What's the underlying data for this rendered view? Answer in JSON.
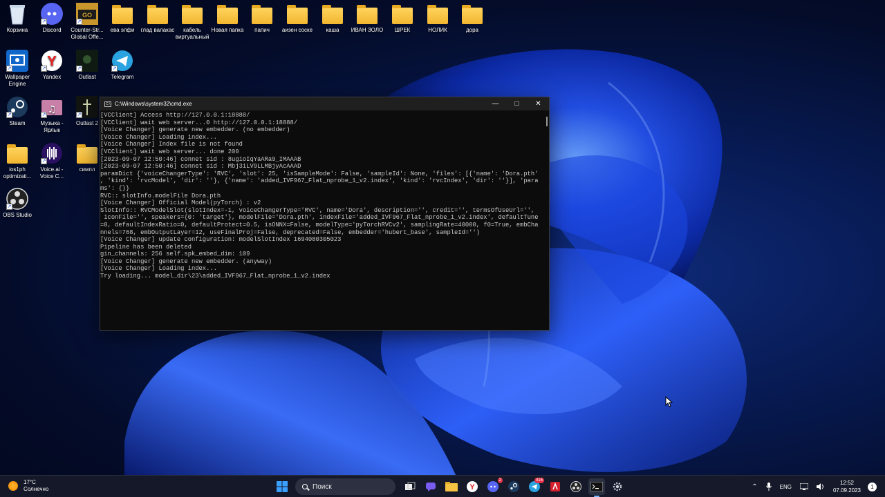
{
  "desktop": {
    "row1": [
      {
        "name": "recycle-bin",
        "label": "Корзина",
        "kind": "recycle",
        "shortcut": false
      },
      {
        "name": "discord",
        "label": "Discord",
        "kind": "discord",
        "shortcut": true
      },
      {
        "name": "counter-strike",
        "label": "Counter-Str... Global Offe...",
        "kind": "csgo",
        "shortcut": true
      },
      {
        "name": "folder-eva-elfi",
        "label": "ева элфи",
        "kind": "folder",
        "shortcut": false
      },
      {
        "name": "folder-glad-valakas",
        "label": "глад валакас",
        "kind": "folder",
        "shortcut": false
      },
      {
        "name": "folder-kabel",
        "label": "кабель виртуальный",
        "kind": "folder",
        "shortcut": false
      },
      {
        "name": "folder-new",
        "label": "Новая папка",
        "kind": "folder",
        "shortcut": false
      },
      {
        "name": "folder-papich",
        "label": "папич",
        "kind": "folder",
        "shortcut": false
      },
      {
        "name": "folder-aizen",
        "label": "аизен соске",
        "kind": "folder",
        "shortcut": false
      },
      {
        "name": "folder-kasha",
        "label": "каша",
        "kind": "folder",
        "shortcut": false
      },
      {
        "name": "folder-ivan-zolo",
        "label": "ИВАН ЗОЛО",
        "kind": "folder",
        "shortcut": false
      },
      {
        "name": "folder-shrek",
        "label": "ШРЕК",
        "kind": "folder",
        "shortcut": false
      },
      {
        "name": "folder-nolik",
        "label": "НОЛИК",
        "kind": "folder",
        "shortcut": false
      },
      {
        "name": "folder-dora",
        "label": "дора",
        "kind": "folder",
        "shortcut": false
      }
    ],
    "col_icons": [
      {
        "name": "wallpaper-engine",
        "label": "Wallpaper Engine",
        "kind": "wallpaper",
        "shortcut": true
      },
      {
        "name": "yandex",
        "label": "Yandex",
        "kind": "yandex",
        "shortcut": true
      },
      {
        "name": "outlast",
        "label": "Outlast",
        "kind": "outlast",
        "shortcut": true
      },
      {
        "name": "telegram",
        "label": "Telegram",
        "kind": "telegram",
        "shortcut": true
      },
      {
        "name": "steam",
        "label": "Steam",
        "kind": "steam",
        "shortcut": true
      },
      {
        "name": "music",
        "label": "Музыка - Ярлык",
        "kind": "music",
        "shortcut": true
      },
      {
        "name": "outlast-2",
        "label": "Outlast 2",
        "kind": "outlast2",
        "shortcut": true
      },
      {
        "name": "ios1ph",
        "label": "ios1ph optimizati...",
        "kind": "folder",
        "shortcut": false
      },
      {
        "name": "voice-ai",
        "label": "Voice.ai - Voice C...",
        "kind": "voiceai",
        "shortcut": true
      },
      {
        "name": "simpl",
        "label": "симпл",
        "kind": "folder",
        "shortcut": false
      },
      {
        "name": "obs-studio",
        "label": "OBS Studio",
        "kind": "obs",
        "shortcut": true
      }
    ]
  },
  "cmd": {
    "title": "C:\\Windows\\system32\\cmd.exe",
    "lines": [
      "[VCClient] Access http://127.0.0.1:18888/",
      "[VCClient] wait web server...0 http://127.0.0.1:18888/",
      "[Voice Changer] generate new embedder. (no embedder)",
      "[Voice Changer] Loading index...",
      "[Voice Changer] Index file is not found",
      "[VCClient] wait web server... done 200",
      "[2023-09-07 12:50:46] connet sid : 8ugioIqYaARa9_IMAAAB",
      "[2023-09-07 12:50:46] connet sid : Mbj3iLV9LLMBjyAcAAAD",
      "paramDict {'voiceChangerType': 'RVC', 'slot': 25, 'isSampleMode': False, 'sampleId': None, 'files': [{'name': 'Dora.pth'",
      ", 'kind': 'rvcModel', 'dir': ''}, {'name': 'added_IVF967_Flat_nprobe_1_v2.index', 'kind': 'rvcIndex', 'dir': ''}], 'para",
      "ms': {}}",
      "RVC:: slotInfo.modelFile Dora.pth",
      "[Voice Changer] Official Model(pyTorch) : v2",
      "SlotInfo:: RVCModelSlot(slotIndex=-1, voiceChangerType='RVC', name='Dora', description='', credit='', termsOfUseUrl='',",
      " iconFile='', speakers={0: 'target'}, modelFile='Dora.pth', indexFile='added_IVF967_Flat_nprobe_1_v2.index', defaultTune",
      "=0, defaultIndexRatio=0, defaultProtect=0.5, isONNX=False, modelType='pyTorchRVCv2', samplingRate=40000, f0=True, embCha",
      "nnels=768, embOutputLayer=12, useFinalProj=False, deprecated=False, embedder='hubert_base', sampleId='')",
      "[Voice Changer] update configuration: modelSlotIndex 1694080305023",
      "Pipeline has been deleted",
      "gin_channels: 256 self.spk_embed_dim: 109",
      "[Voice Changer] generate new embedder. (anyway)",
      "[Voice Changer] Loading index...",
      "Try loading... model_dir\\23\\added_IVF967_Flat_nprobe_1_v2.index"
    ]
  },
  "taskbar": {
    "weather_temp": "17°C",
    "weather_desc": "Солнечно",
    "search_placeholder": "Поиск",
    "apps": [
      {
        "name": "start-button",
        "icon": "windows-logo-icon"
      },
      {
        "name": "task-view",
        "icon": "task-view-icon"
      },
      {
        "name": "chat",
        "icon": "chat-icon"
      },
      {
        "name": "file-explorer",
        "icon": "folder-icon"
      },
      {
        "name": "yandex-taskbar",
        "icon": "yandex-icon"
      },
      {
        "name": "discord-taskbar",
        "icon": "discord-icon",
        "badge": "2"
      },
      {
        "name": "steam-taskbar",
        "icon": "steam-icon"
      },
      {
        "name": "telegram-taskbar",
        "icon": "telegram-icon",
        "badge": "416"
      },
      {
        "name": "app-red",
        "icon": "red-app-icon"
      },
      {
        "name": "obs-taskbar",
        "icon": "obs-icon"
      },
      {
        "name": "cmd-taskbar",
        "icon": "terminal-icon"
      },
      {
        "name": "settings-taskbar",
        "icon": "gear-icon"
      }
    ],
    "lang": "ENG",
    "time": "12:52",
    "date": "07.09.2023",
    "notif_count": "1"
  }
}
